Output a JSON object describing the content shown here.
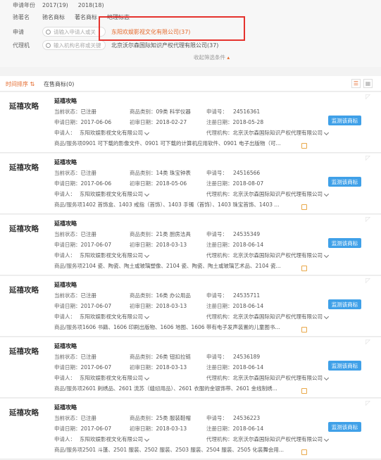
{
  "filter": {
    "year": {
      "label": "申请年份",
      "items": [
        "2017(19)",
        "2018(18)"
      ]
    },
    "famous": {
      "label": "驰著名",
      "items": [
        "驰名商标",
        "著名商标",
        "地理标志"
      ]
    },
    "applicant": {
      "label": "申请",
      "placeholder": "请输入申请人或关",
      "selected": "东阳欢娱影视文化有限公司(37)"
    },
    "agent": {
      "label": "代理机",
      "placeholder": "输入机构名称或关键",
      "selected": "北京沃尔森国际知识产权代理有限公司(37)"
    },
    "collapse": "收起筛选条件",
    "collapse_icon": "up-triangle-icon"
  },
  "tabs": {
    "sort": "时间排序",
    "on_sale": "在售商标(0)"
  },
  "monitor_label": "监测该商标",
  "labels": {
    "status": "当前状态：",
    "category": "商品类别：",
    "reg_no": "申请号：",
    "apply_date": "申请日期：",
    "first_trial": "初审日期：",
    "reg_date": "注册日期：",
    "applicant": "申请人：",
    "agent": "代理机构：",
    "goods": "商品/服务项"
  },
  "trademarks": [
    {
      "brand": "延禧攻略",
      "name": "延禧攻略",
      "status": "已注册",
      "category": "09类 科学仪器",
      "reg_no": "24516361",
      "apply_date": "2017-06-06",
      "first_trial": "2018-02-27",
      "reg_date": "2018-05-28",
      "applicant": "东阳欢娱影视文化有限公司",
      "agent": "北京沃尔森国际知识产权代理有限公司",
      "goods": "0901 可下载的影像文件、0901 可下载的计算机应用软件、0901 电子出版物（可..."
    },
    {
      "brand": "延禧攻略",
      "name": "延禧攻略",
      "status": "已注册",
      "category": "14类 珠宝钟表",
      "reg_no": "24516566",
      "apply_date": "2017-06-06",
      "first_trial": "2018-05-06",
      "reg_date": "2018-08-07",
      "applicant": "东阳欢娱影视文化有限公司",
      "agent": "北京沃尔森国际知识产权代理有限公司",
      "goods": "1402 首饰盒、1403 戒指（首饰）、1403 手镯（首饰）、1403 珠宝首饰、1403 ..."
    },
    {
      "brand": "延禧攻略",
      "name": "延禧攻略",
      "status": "已注册",
      "category": "21类 厨房洁具",
      "reg_no": "24535349",
      "apply_date": "2017-06-07",
      "first_trial": "2018-03-13",
      "reg_date": "2018-06-14",
      "applicant": "东阳欢娱影视文化有限公司",
      "agent": "北京沃尔森国际知识产权代理有限公司",
      "goods": "2104 瓷、陶瓷、陶土或玻璃塑像、2104 瓷、陶瓷、陶土或玻璃艺术品、2104 瓷..."
    },
    {
      "brand": "延禧攻略",
      "name": "延禧攻略",
      "status": "已注册",
      "category": "16类 办公用品",
      "reg_no": "24535711",
      "apply_date": "2017-06-07",
      "first_trial": "2018-03-13",
      "reg_date": "2018-06-14",
      "applicant": "东阳欢娱影视文化有限公司",
      "agent": "北京沃尔森国际知识产权代理有限公司",
      "goods": "1606 书籍、1606 印刷出版物、1606 地图、1606 带有电子发声装置的儿童图书..."
    },
    {
      "brand": "延禧攻略",
      "name": "延禧攻略",
      "status": "已注册",
      "category": "26类 钮扣拉链",
      "reg_no": "24536189",
      "apply_date": "2017-06-07",
      "first_trial": "2018-03-13",
      "reg_date": "2018-06-14",
      "applicant": "东阳欢娱影视文化有限公司",
      "agent": "北京沃尔森国际知识产权代理有限公司",
      "goods": "2601 刺绣品、2601 流苏（缝纫用品）、2601 衣服的金银饰带、2601 金线制绣..."
    },
    {
      "brand": "延禧攻略",
      "name": "延禧攻略",
      "status": "已注册",
      "category": "25类 服装鞋帽",
      "reg_no": "24536223",
      "apply_date": "2017-06-07",
      "first_trial": "2018-03-13",
      "reg_date": "2018-06-14",
      "applicant": "东阳欢娱影视文化有限公司",
      "agent": "北京沃尔森国际知识产权代理有限公司",
      "goods": "2501 斗篷、2501 服装、2502 服装、2503 服装、2504 服装、2505 化装舞会用..."
    }
  ]
}
